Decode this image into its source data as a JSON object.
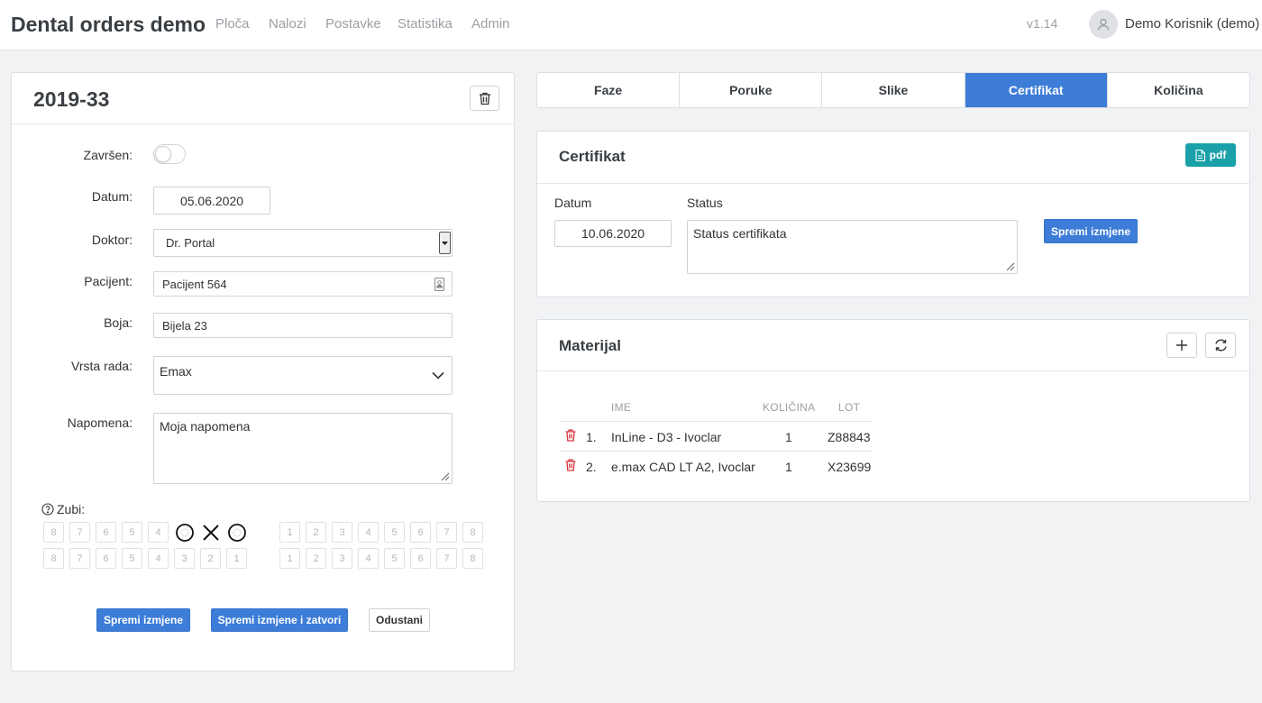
{
  "app": {
    "brand": "Dental orders demo",
    "nav": [
      "Ploča",
      "Nalozi",
      "Postavke",
      "Statistika",
      "Admin"
    ],
    "version": "v1.14",
    "user": "Demo Korisnik (demo)"
  },
  "order": {
    "title": "2019-33",
    "labels": {
      "completed": "Završen:",
      "date": "Datum:",
      "doctor": "Doktor:",
      "patient": "Pacijent:",
      "color": "Boja:",
      "work_type": "Vrsta rada:",
      "note": "Napomena:",
      "teeth": "Zubi:"
    },
    "completed": false,
    "date": "05.06.2020",
    "doctor": "Dr. Portal",
    "patient": "Pacijent 564",
    "color_value": "Bijela 23",
    "work_type": "Emax",
    "note": "Moja napomena",
    "teeth": {
      "upper_left": [
        "8",
        "7",
        "6",
        "5",
        "4"
      ],
      "upper_right": [
        "1",
        "2",
        "3",
        "4",
        "5",
        "6",
        "7",
        "8"
      ],
      "lower_left": [
        "8",
        "7",
        "6",
        "5",
        "4",
        "3",
        "2",
        "1"
      ],
      "lower_right": [
        "1",
        "2",
        "3",
        "4",
        "5",
        "6",
        "7",
        "8"
      ]
    },
    "buttons": {
      "save": "Spremi izmjene",
      "save_close": "Spremi izmjene i zatvori",
      "cancel": "Odustani"
    }
  },
  "tabs": [
    {
      "label": "Faze",
      "active": false
    },
    {
      "label": "Poruke",
      "active": false
    },
    {
      "label": "Slike",
      "active": false
    },
    {
      "label": "Certifikat",
      "active": true
    },
    {
      "label": "Količina",
      "active": false
    }
  ],
  "certificate": {
    "title": "Certifikat",
    "pdf_label": "pdf",
    "date_label": "Datum",
    "status_label": "Status",
    "date": "10.06.2020",
    "status": "Status certifikata",
    "save": "Spremi izmjene"
  },
  "materials": {
    "title": "Materijal",
    "columns": [
      "IME",
      "KOLIČINA",
      "LOT"
    ],
    "rows": [
      {
        "num": "1.",
        "name": "InLine - D3 - Ivoclar",
        "qty": "1",
        "lot": "Z88843"
      },
      {
        "num": "2.",
        "name": "e.max CAD LT A2, Ivoclar",
        "qty": "1",
        "lot": "X23699"
      }
    ]
  },
  "colors": {
    "primary": "#3d7dd8",
    "pdf": "#1aa0a8",
    "danger": "#d9363e"
  }
}
